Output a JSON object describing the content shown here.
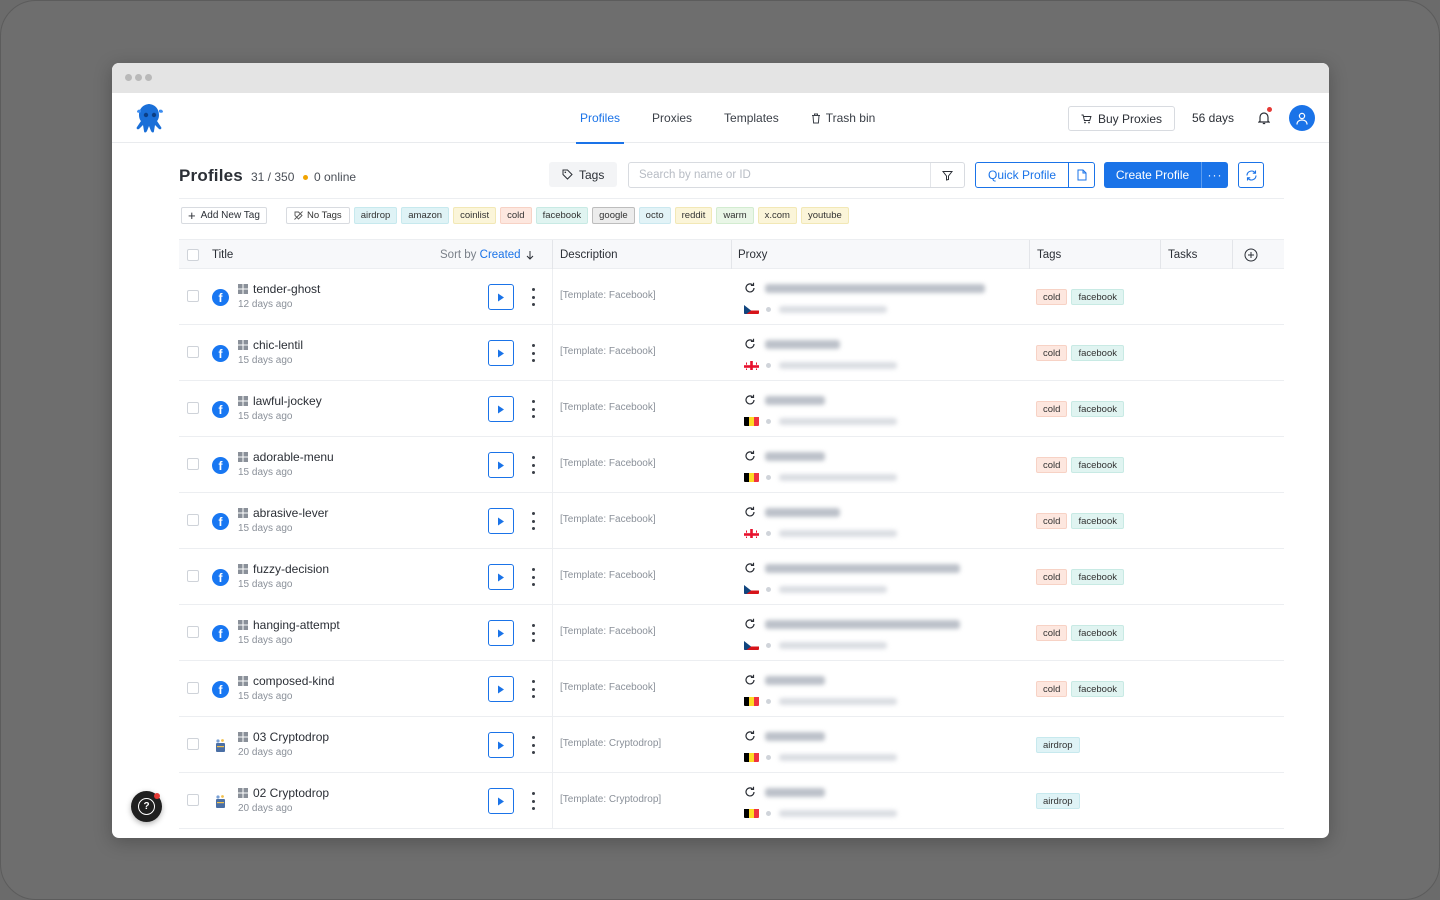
{
  "nav": {
    "items": [
      {
        "label": "Profiles",
        "active": true
      },
      {
        "label": "Proxies",
        "active": false
      },
      {
        "label": "Templates",
        "active": false
      },
      {
        "label": "Trash bin",
        "active": false,
        "icon": "trash-icon"
      }
    ],
    "buy_proxies": "Buy Proxies",
    "days_left": "56 days"
  },
  "header": {
    "title": "Profiles",
    "count": "31 / 350",
    "online": "0 online",
    "tags_button": "Tags",
    "search_placeholder": "Search by name or ID",
    "quick_profile": "Quick Profile",
    "create_profile": "Create Profile"
  },
  "tagbar": {
    "add_new_tag": "Add New Tag",
    "no_tags": "No Tags",
    "tags": [
      {
        "label": "airdrop",
        "bg": "#dff3f6",
        "border": "#c7e9ee"
      },
      {
        "label": "amazon",
        "bg": "#dff3f6",
        "border": "#c7e9ee"
      },
      {
        "label": "coinlist",
        "bg": "#fbf5d9",
        "border": "#f2e8b6"
      },
      {
        "label": "cold",
        "bg": "#fde7df",
        "border": "#f7d2c5"
      },
      {
        "label": "facebook",
        "bg": "#e0f4f1",
        "border": "#c8eae4"
      },
      {
        "label": "google",
        "bg": "#ececec",
        "border": "#bdbdbd"
      },
      {
        "label": "octo",
        "bg": "#e2f3f7",
        "border": "#cbe8ef"
      },
      {
        "label": "reddit",
        "bg": "#fbf5d9",
        "border": "#f2e8b6"
      },
      {
        "label": "warm",
        "bg": "#e9f6e7",
        "border": "#d3ecd0"
      },
      {
        "label": "x.com",
        "bg": "#fbf5d9",
        "border": "#f2e8b6"
      },
      {
        "label": "youtube",
        "bg": "#fbf5d9",
        "border": "#f2e8b6"
      }
    ]
  },
  "table": {
    "col_title": "Title",
    "sort_prefix": "Sort by",
    "sort_field": "Created",
    "col_description": "Description",
    "col_proxy": "Proxy",
    "col_tags": "Tags",
    "col_tasks": "Tasks"
  },
  "rows": [
    {
      "name": "tender-ghost",
      "age": "12 days ago",
      "icon": "facebook-icon",
      "description": "[Template: Facebook]",
      "flag": "cz",
      "tags": [
        "cold",
        "facebook"
      ]
    },
    {
      "name": "chic-lentil",
      "age": "15 days ago",
      "icon": "facebook-icon",
      "description": "[Template: Facebook]",
      "flag": "ge",
      "tags": [
        "cold",
        "facebook"
      ]
    },
    {
      "name": "lawful-jockey",
      "age": "15 days ago",
      "icon": "facebook-icon",
      "description": "[Template: Facebook]",
      "flag": "be",
      "tags": [
        "cold",
        "facebook"
      ]
    },
    {
      "name": "adorable-menu",
      "age": "15 days ago",
      "icon": "facebook-icon",
      "description": "[Template: Facebook]",
      "flag": "be",
      "tags": [
        "cold",
        "facebook"
      ]
    },
    {
      "name": "abrasive-lever",
      "age": "15 days ago",
      "icon": "facebook-icon",
      "description": "[Template: Facebook]",
      "flag": "ge",
      "tags": [
        "cold",
        "facebook"
      ]
    },
    {
      "name": "fuzzy-decision",
      "age": "15 days ago",
      "icon": "facebook-icon",
      "description": "[Template: Facebook]",
      "flag": "cz",
      "tags": [
        "cold",
        "facebook"
      ]
    },
    {
      "name": "hanging-attempt",
      "age": "15 days ago",
      "icon": "facebook-icon",
      "description": "[Template: Facebook]",
      "flag": "cz",
      "tags": [
        "cold",
        "facebook"
      ]
    },
    {
      "name": "composed-kind",
      "age": "15 days ago",
      "icon": "facebook-icon",
      "description": "[Template: Facebook]",
      "flag": "be",
      "tags": [
        "cold",
        "facebook"
      ]
    },
    {
      "name": "03 Cryptodrop",
      "age": "20 days ago",
      "icon": "cryptodrop-icon",
      "description": "[Template: Cryptodrop]",
      "flag": "be",
      "tags": [
        "airdrop"
      ]
    },
    {
      "name": "02 Cryptodrop",
      "age": "20 days ago",
      "icon": "cryptodrop-icon",
      "description": "[Template: Cryptodrop]",
      "flag": "be",
      "tags": [
        "airdrop"
      ]
    }
  ],
  "colors": {
    "accent": "#1a73e8",
    "online_dot": "#f2a400"
  }
}
